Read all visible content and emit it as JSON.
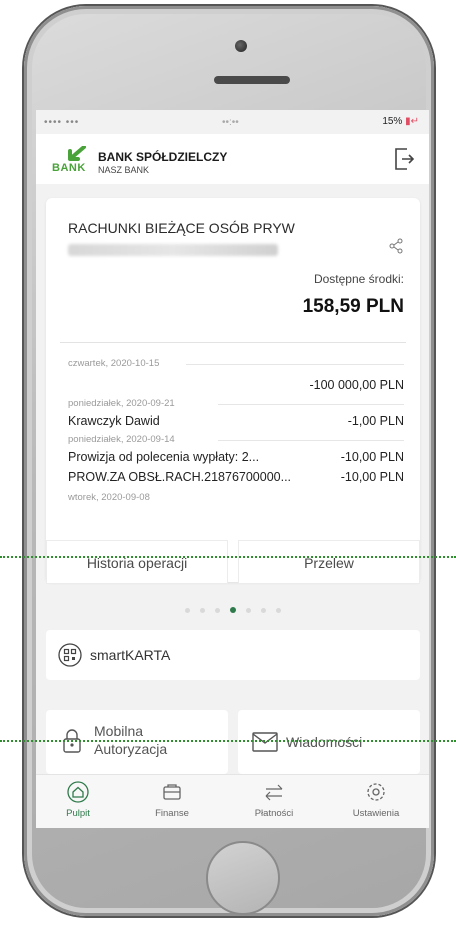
{
  "status_bar": {
    "carrier": "•••• •••",
    "time": "••:••",
    "battery": "15%"
  },
  "header": {
    "logo_text": "BANK",
    "bank_name": "BANK SPÓŁDZIELCZY",
    "bank_sub": "NASZ BANK"
  },
  "account": {
    "title": "RACHUNKI BIEŻĄCE OSÓB PRYW",
    "available_label": "Dostępne środki:",
    "available_amount": "158,59 PLN",
    "transactions": [
      {
        "date": "czwartek, 2020-10-15",
        "name": "",
        "amount": "-100 000,00 PLN"
      },
      {
        "date": "poniedziałek, 2020-09-21",
        "name": "Krawczyk Dawid",
        "amount": "-1,00 PLN"
      },
      {
        "date": "poniedziałek, 2020-09-14",
        "name": "Prowizja od polecenia wypłaty: 2...",
        "amount": "-10,00 PLN"
      },
      {
        "date": "",
        "name": "PROW.ZA OBSŁ.RACH.21876700000...",
        "amount": "-10,00 PLN"
      },
      {
        "date": "wtorek, 2020-09-08",
        "name": "",
        "amount": ""
      }
    ],
    "history_button": "Historia operacji",
    "transfer_button": "Przelew"
  },
  "smart_card": {
    "label": "smartKARTA"
  },
  "tiles": {
    "mobile_auth_line1": "Mobilna",
    "mobile_auth_line2": "Autoryzacja",
    "messages": "Wiadomości"
  },
  "nav": [
    {
      "label": "Pulpit"
    },
    {
      "label": "Finanse"
    },
    {
      "label": "Płatności"
    },
    {
      "label": "Ustawienia"
    }
  ],
  "colors": {
    "brand_green": "#2f7a4b",
    "logo_green": "#4aa33a",
    "battery_bolt": "#e04d63",
    "overlay_dots": "#2f8f2f"
  },
  "pager": {
    "total": 7,
    "active": 4
  }
}
